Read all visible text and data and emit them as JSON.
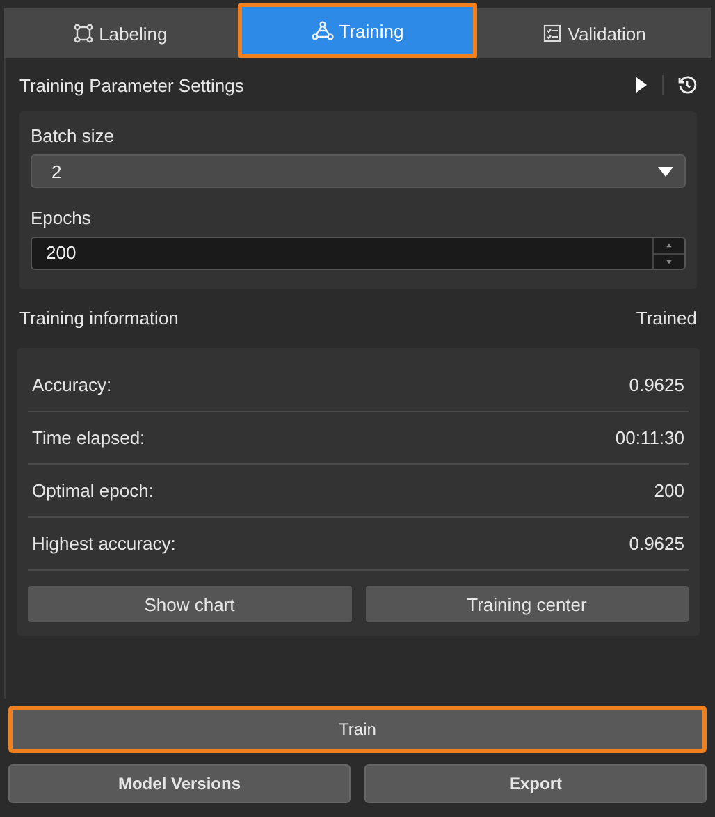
{
  "tabs": [
    {
      "label": "Labeling",
      "kind": "labeling",
      "selected": false,
      "highlighted": false
    },
    {
      "label": "Training",
      "kind": "training",
      "selected": true,
      "highlighted": true
    },
    {
      "label": "Validation",
      "kind": "validation",
      "selected": false,
      "highlighted": false
    }
  ],
  "settings": {
    "title": "Training Parameter Settings",
    "fields": [
      {
        "kind": "dropdown",
        "label": "Batch size",
        "value": "2"
      },
      {
        "kind": "spinbox",
        "label": "Epochs",
        "value": "200"
      }
    ]
  },
  "info": {
    "title": "Training information",
    "status": "Trained",
    "rows": [
      {
        "label": "Accuracy:",
        "value": "0.9625"
      },
      {
        "label": "Time elapsed:",
        "value": "00:11:30"
      },
      {
        "label": "Optimal epoch:",
        "value": "200"
      },
      {
        "label": "Highest accuracy:",
        "value": "0.9625"
      }
    ],
    "buttons": [
      "Show chart",
      "Training center"
    ]
  },
  "actions": {
    "train": {
      "label": "Train",
      "highlighted": true
    },
    "buttons": [
      "Model Versions",
      "Export"
    ]
  }
}
